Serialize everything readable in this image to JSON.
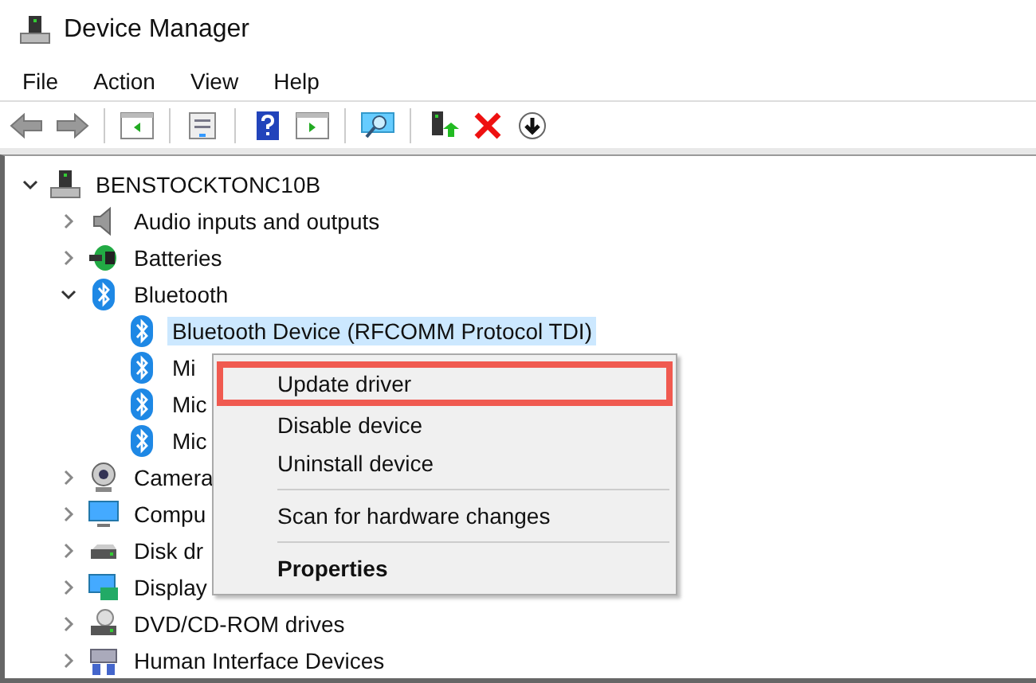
{
  "window": {
    "title": "Device Manager"
  },
  "menu_bar": [
    "File",
    "Action",
    "View",
    "Help"
  ],
  "tree": {
    "label": "BENSTOCKTONC10B",
    "kind": "computer",
    "expanded": true,
    "children": [
      {
        "label": "Audio inputs and outputs",
        "kind": "audio",
        "expanded": false
      },
      {
        "label": "Batteries",
        "kind": "battery",
        "expanded": false
      },
      {
        "label": "Bluetooth",
        "kind": "bluetooth",
        "expanded": true,
        "children": [
          {
            "label": "Bluetooth Device (RFCOMM Protocol TDI)",
            "kind": "bluetooth",
            "selected": true
          },
          {
            "label": "Mi",
            "kind": "bluetooth",
            "selected": false
          },
          {
            "label": "Mic",
            "kind": "bluetooth",
            "selected": false
          },
          {
            "label": "Mic",
            "kind": "bluetooth",
            "selected": false
          }
        ]
      },
      {
        "label": "Camera",
        "kind": "camera",
        "expanded": false
      },
      {
        "label": "Compu",
        "kind": "monitor",
        "expanded": false
      },
      {
        "label": "Disk dr",
        "kind": "disk",
        "expanded": false
      },
      {
        "label": "Display",
        "kind": "display",
        "expanded": false
      },
      {
        "label": "DVD/CD-ROM drives",
        "kind": "dvd",
        "expanded": false
      },
      {
        "label": "Human Interface Devices",
        "kind": "hid",
        "expanded": false
      }
    ]
  },
  "context_menu": [
    {
      "kind": "item",
      "label": "Update driver",
      "selected": true
    },
    {
      "kind": "item",
      "label": "Disable device",
      "selected": false
    },
    {
      "kind": "item",
      "label": "Uninstall device",
      "selected": false
    },
    {
      "kind": "separator"
    },
    {
      "kind": "item",
      "label": "Scan for hardware changes",
      "selected": false
    },
    {
      "kind": "separator"
    },
    {
      "kind": "default",
      "label": "Properties",
      "selected": false
    }
  ]
}
